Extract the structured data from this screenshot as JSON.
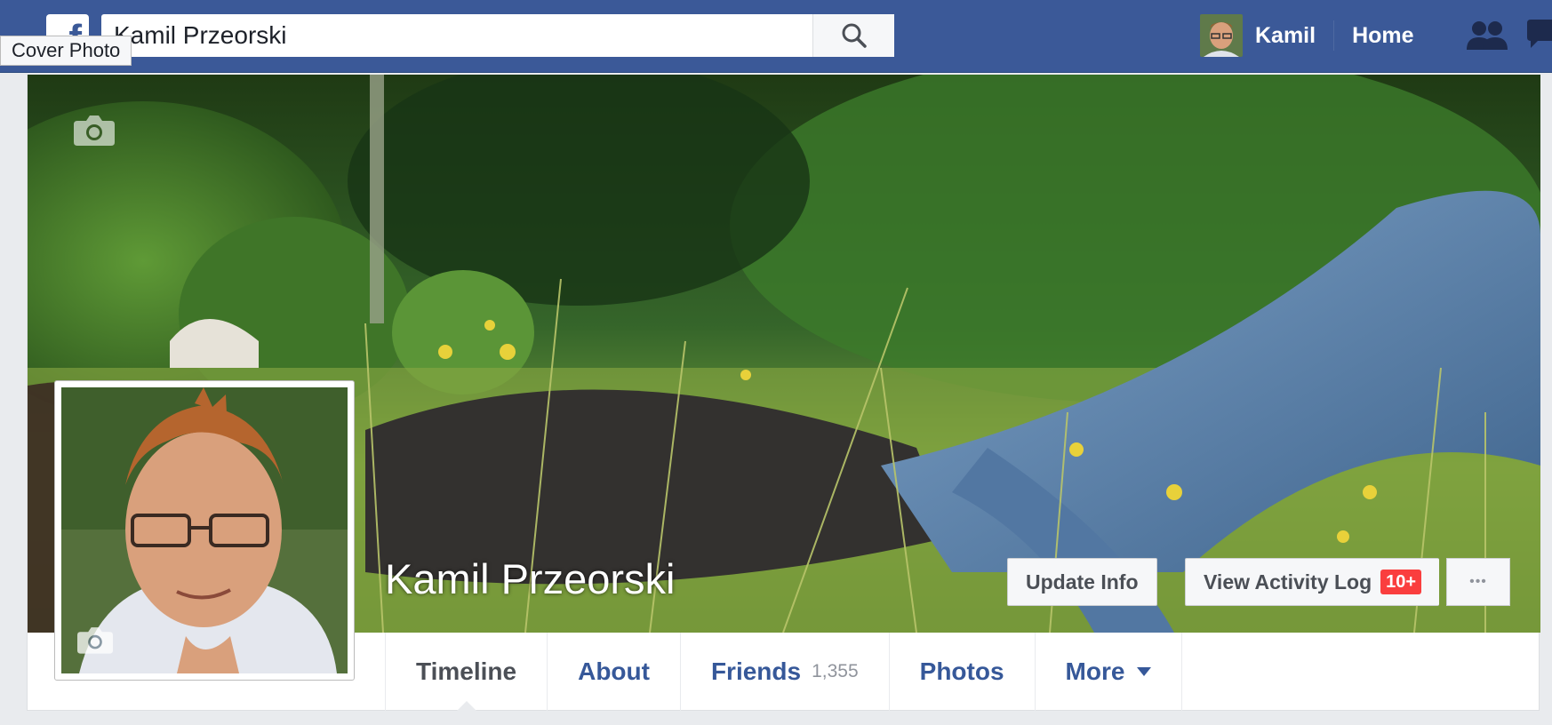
{
  "topbar": {
    "logo": "f",
    "search_value": "Kamil Przeorski",
    "search_icon": "search-icon",
    "tooltip": "Cover Photo",
    "user_name": "Kamil",
    "home_label": "Home",
    "icons": [
      "friends-icon",
      "messages-icon"
    ],
    "color": "#3b5998"
  },
  "profile": {
    "name": "Kamil Przeorski",
    "update_info_label": "Update Info",
    "activity_log_label": "View Activity Log",
    "activity_badge": "10+",
    "more_dots": "•••"
  },
  "tabs": [
    {
      "label": "Timeline",
      "active": true
    },
    {
      "label": "About"
    },
    {
      "label": "Friends",
      "count": "1,355"
    },
    {
      "label": "Photos"
    },
    {
      "label": "More",
      "dropdown": true
    }
  ]
}
